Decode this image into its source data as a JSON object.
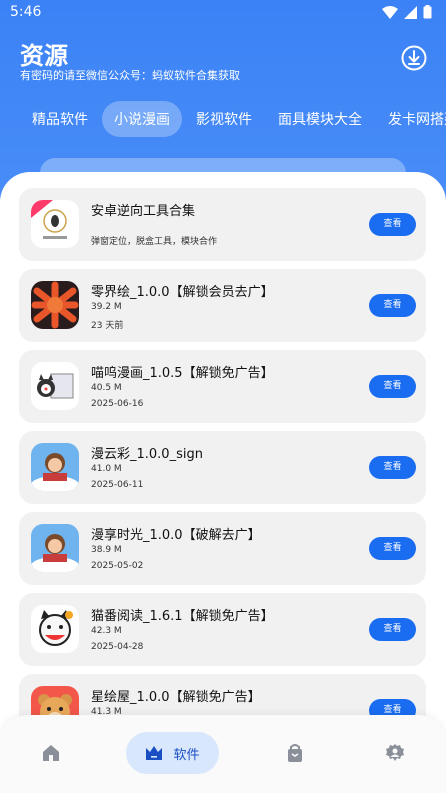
{
  "status": {
    "time": "5:46"
  },
  "header": {
    "title": "资源",
    "subtitle": "有密码的请至微信公众号：蚂蚁软件合集获取"
  },
  "tabs": [
    {
      "label": "精品软件",
      "active": false
    },
    {
      "label": "小说漫画",
      "active": true
    },
    {
      "label": "影视软件",
      "active": false
    },
    {
      "label": "面具模块大全",
      "active": false
    },
    {
      "label": "发卡网搭建",
      "active": false
    }
  ],
  "items": [
    {
      "name": "安卓逆向工具合集",
      "size": "",
      "date": "",
      "desc": "弹窗定位，脱盒工具，模块合作",
      "button": "查看",
      "icon": "ant-logo-icon"
    },
    {
      "name": "零界绘_1.0.0【解锁会员去广】",
      "size": "39.2 M",
      "date": "23 天前",
      "desc": "",
      "button": "查看",
      "icon": "lingjiehui-icon"
    },
    {
      "name": "喵呜漫画_1.0.5【解锁免广告】",
      "size": "40.5 M",
      "date": "2025-06-16",
      "desc": "",
      "button": "查看",
      "icon": "cat-reading-icon"
    },
    {
      "name": "漫云彩_1.0.0_sign",
      "size": "41.0 M",
      "date": "2025-06-11",
      "desc": "",
      "button": "查看",
      "icon": "girl-reading-icon"
    },
    {
      "name": "漫享时光_1.0.0【破解去广】",
      "size": "38.9 M",
      "date": "2025-05-02",
      "desc": "",
      "button": "查看",
      "icon": "girl-reading-icon"
    },
    {
      "name": "猫番阅读_1.6.1【解锁免广告】",
      "size": "42.3 M",
      "date": "2025-04-28",
      "desc": "",
      "button": "查看",
      "icon": "cat-mascot-icon"
    },
    {
      "name": "星绘屋_1.0.0【解锁免广告】",
      "size": "41.3 M",
      "date": "",
      "desc": "",
      "button": "查看",
      "icon": "bear-icon"
    }
  ],
  "nav": {
    "active_label": "软件"
  },
  "colors": {
    "primary": "#1a6cf0",
    "header_bg": "#3b82f6",
    "card_bg": "#f1f1f1"
  }
}
